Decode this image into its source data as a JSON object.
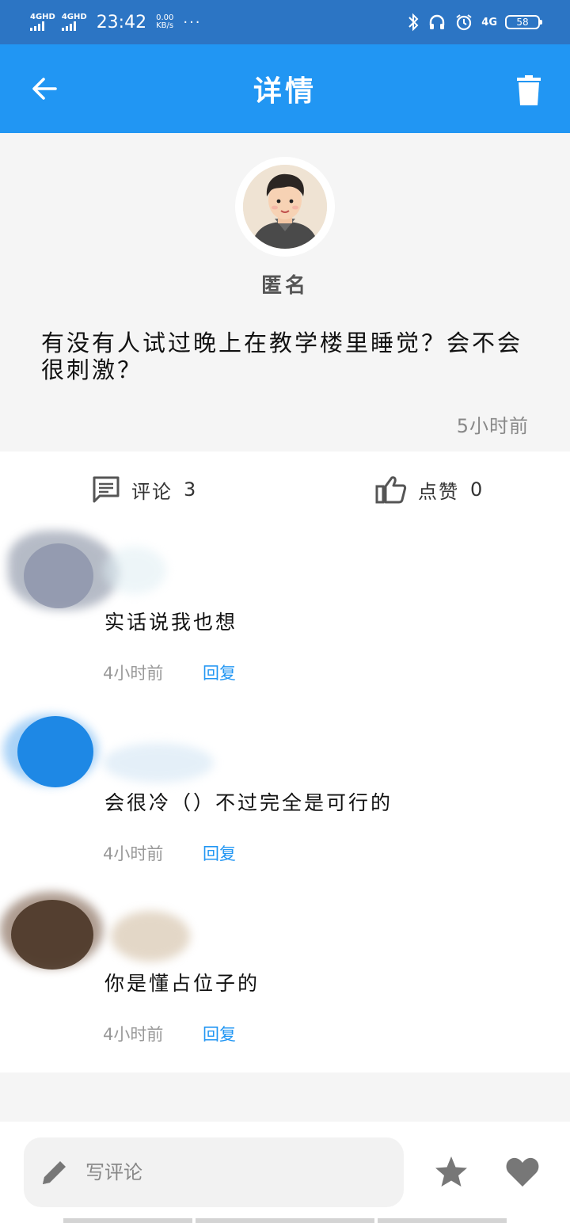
{
  "status_bar": {
    "net1": "4GHD",
    "net2": "4GHD",
    "time": "23:42",
    "speed_value": "0.00",
    "speed_unit": "KB/s",
    "more": "···",
    "network": "4G",
    "battery": "58"
  },
  "app_bar": {
    "title": "详情"
  },
  "post": {
    "author": "匿名",
    "content": "有没有人试过晚上在教学楼里睡觉？会不会很刺激？",
    "time": "5小时前"
  },
  "actions": {
    "comment_label": "评论",
    "comment_count": "3",
    "like_label": "点赞",
    "like_count": "0"
  },
  "comments": [
    {
      "text": "实话说我也想",
      "time": "4小时前",
      "reply": "回复",
      "avatar_color": "#8e95ab"
    },
    {
      "text": "会很冷（）不过完全是可行的",
      "time": "4小时前",
      "reply": "回复",
      "avatar_color": "#1e88e5"
    },
    {
      "text": "你是懂占位子的",
      "time": "4小时前",
      "reply": "回复",
      "avatar_color": "#4a3526"
    }
  ],
  "bottom_bar": {
    "placeholder": "写评论"
  },
  "colors": {
    "status_bar": "#2c75c4",
    "app_bar": "#2196f3",
    "reply": "#2196f3",
    "icon_gray": "#777777"
  }
}
